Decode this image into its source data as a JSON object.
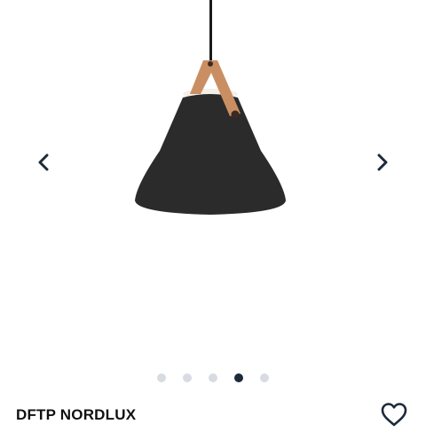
{
  "product": {
    "brand": "DFTP NORDLUX",
    "image_icon": "pendant-lamp-image",
    "colors": {
      "shade": "#2b2b2c",
      "strap": "#c98f62",
      "cord": "#1a1a1a",
      "inner_ring": "#f4f0e8"
    }
  },
  "gallery": {
    "slide_count": 5,
    "active_slide": 4,
    "prev_icon": "chevron-left-icon",
    "next_icon": "chevron-right-icon",
    "dot_color": "#d8dbe2",
    "dot_active_color": "#1c2a3a"
  },
  "actions": {
    "wishlist_icon": "heart-icon"
  }
}
